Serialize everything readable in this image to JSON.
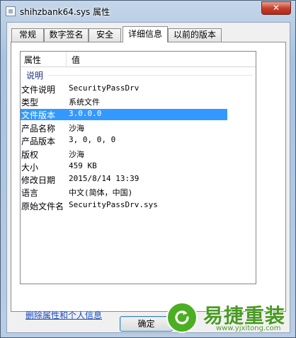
{
  "window": {
    "title": "shihzbank64.sys 属性",
    "close_label": "✕"
  },
  "tabs": [
    {
      "label": "常规"
    },
    {
      "label": "数字签名"
    },
    {
      "label": "安全"
    },
    {
      "label": "详细信息"
    },
    {
      "label": "以前的版本"
    }
  ],
  "list": {
    "header_property": "属性",
    "header_value": "值",
    "group_label": "说明",
    "rows": [
      {
        "name": "文件说明",
        "value": "SecurityPassDrv"
      },
      {
        "name": "类型",
        "value": "系统文件"
      },
      {
        "name": "文件版本",
        "value": "3.0.0.0"
      },
      {
        "name": "产品名称",
        "value": "沙海"
      },
      {
        "name": "产品版本",
        "value": "3, 0, 0, 0"
      },
      {
        "name": "版权",
        "value": "沙海"
      },
      {
        "name": "大小",
        "value": "459 KB"
      },
      {
        "name": "修改日期",
        "value": "2015/8/14 13:39"
      },
      {
        "name": "语言",
        "value": "中文(简体，中国)"
      },
      {
        "name": "原始文件名",
        "value": "SecurityPassDrv.sys"
      }
    ],
    "selected_row": "文件版本"
  },
  "remove_link": "删除属性和个人信息",
  "buttons": {
    "ok": "确定"
  },
  "watermark": {
    "brand": "易捷重装",
    "url": "www.yjxitong.com"
  },
  "colors": {
    "selection": "#3399ff",
    "group_label": "#1e3287",
    "link": "#1a4bbf",
    "watermark_green": "#4caf23"
  }
}
